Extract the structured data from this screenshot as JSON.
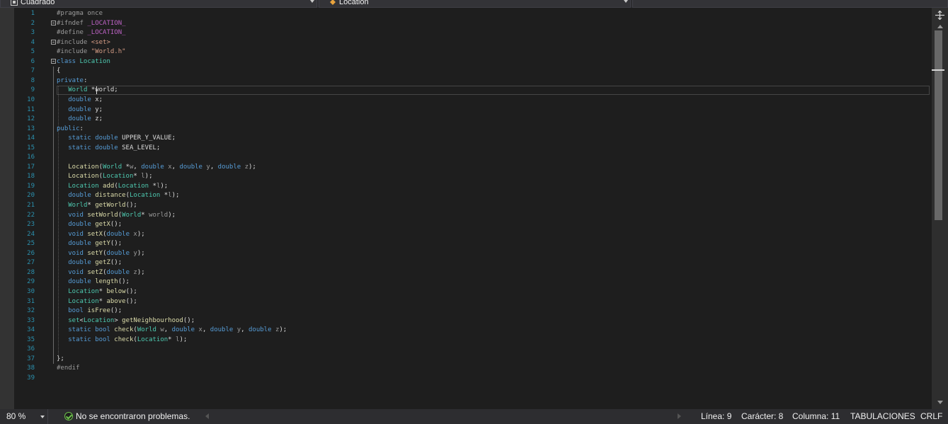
{
  "nav": {
    "project_dropdown": "Cuadrado",
    "scope_dropdown": "Location",
    "member_dropdown": ""
  },
  "code_lines": [
    {
      "num": "1",
      "tokens": [
        [
          "pp",
          "#pragma once"
        ]
      ]
    },
    {
      "num": "2",
      "fold": true,
      "tokens": [
        [
          "pp",
          "#ifndef "
        ],
        [
          "mc",
          "_LOCATION_"
        ]
      ]
    },
    {
      "num": "3",
      "tokens": [
        [
          "pp",
          "#define "
        ],
        [
          "mc",
          "_LOCATION_"
        ]
      ]
    },
    {
      "num": "4",
      "fold": true,
      "tokens": [
        [
          "pp",
          "#include "
        ],
        [
          "st",
          "<set>"
        ]
      ]
    },
    {
      "num": "5",
      "tokens": [
        [
          "pp",
          "#include "
        ],
        [
          "st",
          "\"World.h\""
        ]
      ]
    },
    {
      "num": "6",
      "fold": true,
      "tokens": [
        [
          "kw",
          "class "
        ],
        [
          "ty",
          "Location"
        ]
      ]
    },
    {
      "num": "7",
      "tokens": [
        [
          "tx",
          "{"
        ]
      ]
    },
    {
      "num": "8",
      "tokens": [
        [
          "kw",
          "private"
        ],
        [
          "tx",
          ":"
        ]
      ]
    },
    {
      "num": "9",
      "tokens": [
        [
          "tx",
          "   "
        ],
        [
          "ty",
          "World"
        ],
        [
          "tx",
          " *world;"
        ]
      ]
    },
    {
      "num": "10",
      "tokens": [
        [
          "tx",
          "   "
        ],
        [
          "kw",
          "double"
        ],
        [
          "tx",
          " x;"
        ]
      ]
    },
    {
      "num": "11",
      "tokens": [
        [
          "tx",
          "   "
        ],
        [
          "kw",
          "double"
        ],
        [
          "tx",
          " y;"
        ]
      ]
    },
    {
      "num": "12",
      "tokens": [
        [
          "tx",
          "   "
        ],
        [
          "kw",
          "double"
        ],
        [
          "tx",
          " z;"
        ]
      ]
    },
    {
      "num": "13",
      "tokens": [
        [
          "kw",
          "public"
        ],
        [
          "tx",
          ":"
        ]
      ]
    },
    {
      "num": "14",
      "tokens": [
        [
          "tx",
          "   "
        ],
        [
          "kw",
          "static double"
        ],
        [
          "tx",
          " UPPER_Y_VALUE;"
        ]
      ]
    },
    {
      "num": "15",
      "tokens": [
        [
          "tx",
          "   "
        ],
        [
          "kw",
          "static double"
        ],
        [
          "tx",
          " SEA_LEVEL;"
        ]
      ]
    },
    {
      "num": "16",
      "tokens": []
    },
    {
      "num": "17",
      "tokens": [
        [
          "tx",
          "   "
        ],
        [
          "fn",
          "Location"
        ],
        [
          "tx",
          "("
        ],
        [
          "ty",
          "World"
        ],
        [
          "tx",
          " *"
        ],
        [
          "pa",
          "w"
        ],
        [
          "tx",
          ", "
        ],
        [
          "kw",
          "double"
        ],
        [
          "tx",
          " "
        ],
        [
          "pa",
          "x"
        ],
        [
          "tx",
          ", "
        ],
        [
          "kw",
          "double"
        ],
        [
          "tx",
          " "
        ],
        [
          "pa",
          "y"
        ],
        [
          "tx",
          ", "
        ],
        [
          "kw",
          "double"
        ],
        [
          "tx",
          " "
        ],
        [
          "pa",
          "z"
        ],
        [
          "tx",
          ");"
        ]
      ]
    },
    {
      "num": "18",
      "tokens": [
        [
          "tx",
          "   "
        ],
        [
          "fn",
          "Location"
        ],
        [
          "tx",
          "("
        ],
        [
          "ty",
          "Location"
        ],
        [
          "tx",
          "* "
        ],
        [
          "pa",
          "l"
        ],
        [
          "tx",
          ");"
        ]
      ]
    },
    {
      "num": "19",
      "tokens": [
        [
          "tx",
          "   "
        ],
        [
          "ty",
          "Location"
        ],
        [
          "tx",
          " "
        ],
        [
          "fn",
          "add"
        ],
        [
          "tx",
          "("
        ],
        [
          "ty",
          "Location"
        ],
        [
          "tx",
          " *"
        ],
        [
          "pa",
          "l"
        ],
        [
          "tx",
          ");"
        ]
      ]
    },
    {
      "num": "20",
      "tokens": [
        [
          "tx",
          "   "
        ],
        [
          "kw",
          "double"
        ],
        [
          "tx",
          " "
        ],
        [
          "fn",
          "distance"
        ],
        [
          "tx",
          "("
        ],
        [
          "ty",
          "Location"
        ],
        [
          "tx",
          " *"
        ],
        [
          "pa",
          "l"
        ],
        [
          "tx",
          ");"
        ]
      ]
    },
    {
      "num": "21",
      "tokens": [
        [
          "tx",
          "   "
        ],
        [
          "ty",
          "World"
        ],
        [
          "tx",
          "* "
        ],
        [
          "fn",
          "getWorld"
        ],
        [
          "tx",
          "();"
        ]
      ]
    },
    {
      "num": "22",
      "tokens": [
        [
          "tx",
          "   "
        ],
        [
          "kw",
          "void"
        ],
        [
          "tx",
          " "
        ],
        [
          "fn",
          "setWorld"
        ],
        [
          "tx",
          "("
        ],
        [
          "ty",
          "World"
        ],
        [
          "tx",
          "* "
        ],
        [
          "pa",
          "world"
        ],
        [
          "tx",
          ");"
        ]
      ]
    },
    {
      "num": "23",
      "tokens": [
        [
          "tx",
          "   "
        ],
        [
          "kw",
          "double"
        ],
        [
          "tx",
          " "
        ],
        [
          "fn",
          "getX"
        ],
        [
          "tx",
          "();"
        ]
      ]
    },
    {
      "num": "24",
      "tokens": [
        [
          "tx",
          "   "
        ],
        [
          "kw",
          "void"
        ],
        [
          "tx",
          " "
        ],
        [
          "fn",
          "setX"
        ],
        [
          "tx",
          "("
        ],
        [
          "kw",
          "double"
        ],
        [
          "tx",
          " "
        ],
        [
          "pa",
          "x"
        ],
        [
          "tx",
          ");"
        ]
      ]
    },
    {
      "num": "25",
      "tokens": [
        [
          "tx",
          "   "
        ],
        [
          "kw",
          "double"
        ],
        [
          "tx",
          " "
        ],
        [
          "fn",
          "getY"
        ],
        [
          "tx",
          "();"
        ]
      ]
    },
    {
      "num": "26",
      "tokens": [
        [
          "tx",
          "   "
        ],
        [
          "kw",
          "void"
        ],
        [
          "tx",
          " "
        ],
        [
          "fn",
          "setY"
        ],
        [
          "tx",
          "("
        ],
        [
          "kw",
          "double"
        ],
        [
          "tx",
          " "
        ],
        [
          "pa",
          "y"
        ],
        [
          "tx",
          ");"
        ]
      ]
    },
    {
      "num": "27",
      "tokens": [
        [
          "tx",
          "   "
        ],
        [
          "kw",
          "double"
        ],
        [
          "tx",
          " "
        ],
        [
          "fn",
          "getZ"
        ],
        [
          "tx",
          "();"
        ]
      ]
    },
    {
      "num": "28",
      "tokens": [
        [
          "tx",
          "   "
        ],
        [
          "kw",
          "void"
        ],
        [
          "tx",
          " "
        ],
        [
          "fn",
          "setZ"
        ],
        [
          "tx",
          "("
        ],
        [
          "kw",
          "double"
        ],
        [
          "tx",
          " "
        ],
        [
          "pa",
          "z"
        ],
        [
          "tx",
          ");"
        ]
      ]
    },
    {
      "num": "29",
      "tokens": [
        [
          "tx",
          "   "
        ],
        [
          "kw",
          "double"
        ],
        [
          "tx",
          " "
        ],
        [
          "fn",
          "length"
        ],
        [
          "tx",
          "();"
        ]
      ]
    },
    {
      "num": "30",
      "tokens": [
        [
          "tx",
          "   "
        ],
        [
          "ty",
          "Location"
        ],
        [
          "tx",
          "* "
        ],
        [
          "fn",
          "below"
        ],
        [
          "tx",
          "();"
        ]
      ]
    },
    {
      "num": "31",
      "tokens": [
        [
          "tx",
          "   "
        ],
        [
          "ty",
          "Location"
        ],
        [
          "tx",
          "* "
        ],
        [
          "fn",
          "above"
        ],
        [
          "tx",
          "();"
        ]
      ]
    },
    {
      "num": "32",
      "tokens": [
        [
          "tx",
          "   "
        ],
        [
          "kw",
          "bool"
        ],
        [
          "tx",
          " "
        ],
        [
          "fn",
          "isFree"
        ],
        [
          "tx",
          "();"
        ]
      ]
    },
    {
      "num": "33",
      "tokens": [
        [
          "tx",
          "   "
        ],
        [
          "ty",
          "set"
        ],
        [
          "tx",
          "<"
        ],
        [
          "ty",
          "Location"
        ],
        [
          "tx",
          "> "
        ],
        [
          "fn",
          "getNeighbourhood"
        ],
        [
          "tx",
          "();"
        ]
      ]
    },
    {
      "num": "34",
      "tokens": [
        [
          "tx",
          "   "
        ],
        [
          "kw",
          "static bool"
        ],
        [
          "tx",
          " "
        ],
        [
          "fn",
          "check"
        ],
        [
          "tx",
          "("
        ],
        [
          "ty",
          "World"
        ],
        [
          "tx",
          " "
        ],
        [
          "pa",
          "w"
        ],
        [
          "tx",
          ", "
        ],
        [
          "kw",
          "double"
        ],
        [
          "tx",
          " "
        ],
        [
          "pa",
          "x"
        ],
        [
          "tx",
          ", "
        ],
        [
          "kw",
          "double"
        ],
        [
          "tx",
          " "
        ],
        [
          "pa",
          "y"
        ],
        [
          "tx",
          ", "
        ],
        [
          "kw",
          "double"
        ],
        [
          "tx",
          " "
        ],
        [
          "pa",
          "z"
        ],
        [
          "tx",
          ");"
        ]
      ]
    },
    {
      "num": "35",
      "tokens": [
        [
          "tx",
          "   "
        ],
        [
          "kw",
          "static bool"
        ],
        [
          "tx",
          " "
        ],
        [
          "fn",
          "check"
        ],
        [
          "tx",
          "("
        ],
        [
          "ty",
          "Location"
        ],
        [
          "tx",
          "* "
        ],
        [
          "pa",
          "l"
        ],
        [
          "tx",
          ");"
        ]
      ]
    },
    {
      "num": "36",
      "tokens": []
    },
    {
      "num": "37",
      "tokens": [
        [
          "tx",
          "};"
        ]
      ]
    },
    {
      "num": "38",
      "tokens": [
        [
          "pp",
          "#endif"
        ]
      ]
    },
    {
      "num": "39",
      "tokens": []
    }
  ],
  "editor": {
    "current_line": 9,
    "current_col": 8
  },
  "status": {
    "zoom": "80 %",
    "problems": "No se encontraron problemas.",
    "line": "Línea: 9",
    "char": "Carácter: 8",
    "col": "Columna: 11",
    "indent": "TABULACIONES",
    "eol": "CRLF"
  },
  "colors": {
    "background": "#1e1e1e",
    "line_number": "#2b91af",
    "keyword": "#569cd6",
    "type": "#4ec9b0",
    "function": "#dcdcaa",
    "string": "#d69d85",
    "macro": "#bd63c5",
    "ok": "#6cc24a"
  }
}
